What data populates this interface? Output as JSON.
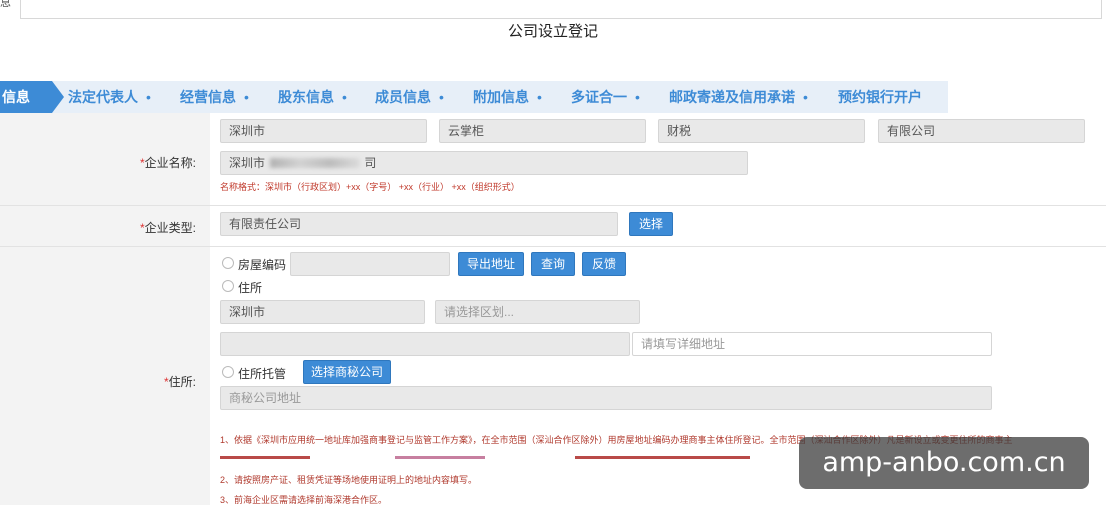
{
  "corner_label": "息",
  "page_title": "公司设立登记",
  "tabs": {
    "active": "信息",
    "items": [
      "法定代表人",
      "经营信息",
      "股东信息",
      "成员信息",
      "附加信息",
      "多证合一",
      "邮政寄递及信用承诺",
      "预约银行开户"
    ],
    "separator": "•"
  },
  "company_name": {
    "label": "*企业名称:",
    "parts": [
      "深圳市",
      "云掌柜",
      "财税",
      "有限公司"
    ],
    "full_value": "深圳市",
    "full_value_tail": "司",
    "format_hint": "名称格式：深圳市（行政区划）+xx（字号） +xx（行业） +xx（组织形式）"
  },
  "company_type": {
    "label": "*企业类型:",
    "value": "有限责任公司",
    "select_button": "选择"
  },
  "address": {
    "label": "*住所:",
    "house_code_label": "房屋编码",
    "export_button": "导出地址",
    "query_button": "查询",
    "feedback_button": "反馈",
    "residence_label": "住所",
    "city_value": "深圳市",
    "district_placeholder": "请选择区划...",
    "detail_placeholder": "请填写详细地址",
    "hosting_label": "住所托管",
    "select_secretary_button": "选择商秘公司",
    "secretary_placeholder": "商秘公司地址"
  },
  "notes": [
    "1、依据《深圳市应用统一地址库加强商事登记与监管工作方案》，在全市范围（深汕合作区除外）用房屋地址编码办理商事主体住所登记。全市范围（深汕合作区除外）凡是新设立或变更住所的商事主",
    "2、请按照房产证、租赁凭证等场地使用证明上的地址内容填写。",
    "3、前海企业区需请选择前海深港合作区。"
  ],
  "watermark": "amp-anbo.com.cn"
}
